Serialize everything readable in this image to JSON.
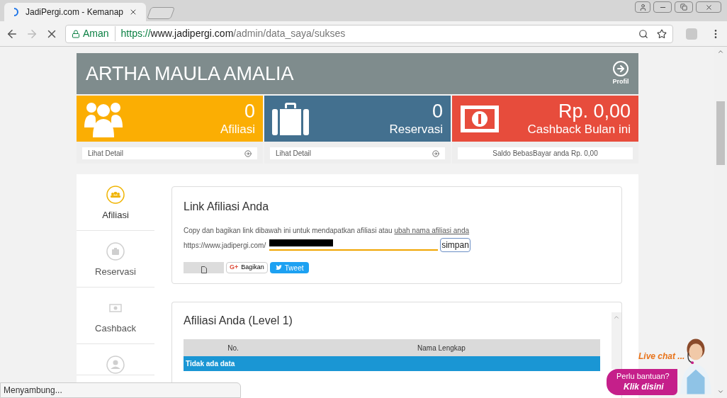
{
  "browser": {
    "tab_title": "JadiPergi.com - Kemanap",
    "loading": true,
    "secure_label": "Aman",
    "url_scheme": "https://",
    "url_host": "www.jadipergi.com",
    "url_path": "/admin/data_saya/sukses"
  },
  "header": {
    "name": "ARTHA MAULA AMALIA",
    "profile_label": "Profil"
  },
  "stats": [
    {
      "kind": "affiliate",
      "value": "0",
      "label": "Afiliasi",
      "footer": "Lihat Detail",
      "footer_arrow": true,
      "color": "#fbae03"
    },
    {
      "kind": "reservation",
      "value": "0",
      "label": "Reservasi",
      "footer": "Lihat Detail",
      "footer_arrow": true,
      "color": "#43708f"
    },
    {
      "kind": "cashback",
      "value": "Rp. 0,00",
      "label": "Cashback Bulan ini",
      "footer": "Saldo BebasBayar anda Rp. 0,00",
      "footer_arrow": false,
      "color": "#e74c3c"
    }
  ],
  "sidebar": {
    "items": [
      {
        "kind": "affiliate",
        "label": "Afiliasi",
        "selected": true
      },
      {
        "kind": "reservation",
        "label": "Reservasi",
        "selected": false
      },
      {
        "kind": "cashback",
        "label": "Cashback",
        "selected": false
      },
      {
        "kind": "profile",
        "selected": false
      }
    ]
  },
  "link_card": {
    "title": "Link Afiliasi Anda",
    "description": "Copy dan bagikan link dibawah ini untuk mendapatkan afiliasi atau",
    "rename_link": "ubah nama afiliasi anda",
    "url_prefix": "https://www.jadipergi.com/",
    "save_button": "simpan",
    "share_buttons": [
      {
        "kind": "blank"
      },
      {
        "kind": "google",
        "icon_text": "G+",
        "label": "Bagikan"
      },
      {
        "kind": "twitter",
        "label": "Tweet"
      }
    ]
  },
  "table": {
    "title": "Afiliasi Anda (Level 1)",
    "columns": [
      "No.",
      "Nama Lengkap"
    ],
    "empty_message": "Tidak ada data"
  },
  "live_chat": {
    "heading": "Live chat ...",
    "question": "Perlu bantuan?",
    "action": "Klik disini"
  },
  "status_bar": "Menyambung..."
}
